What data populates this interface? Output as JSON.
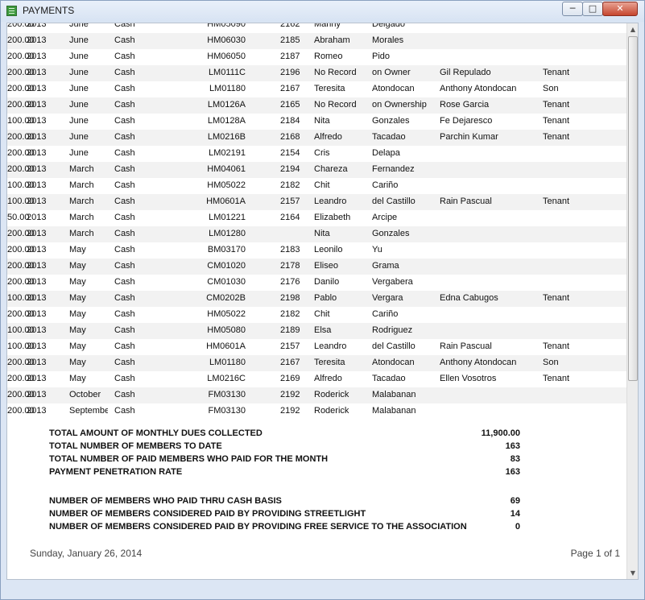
{
  "window": {
    "title": "PAYMENTS",
    "btn_min": "─",
    "btn_max": "□",
    "btn_close": "✕"
  },
  "rows": [
    {
      "year": "2013",
      "month": "June",
      "type": "Cash",
      "code": "HM05090",
      "amount": "200.00",
      "no": "2162",
      "first": "Manny",
      "last": "Delgado",
      "rep": "",
      "rel": ""
    },
    {
      "year": "2013",
      "month": "June",
      "type": "Cash",
      "code": "HM06030",
      "amount": "200.00",
      "no": "2185",
      "first": "Abraham",
      "last": "Morales",
      "rep": "",
      "rel": ""
    },
    {
      "year": "2013",
      "month": "June",
      "type": "Cash",
      "code": "HM06050",
      "amount": "200.00",
      "no": "2187",
      "first": "Romeo",
      "last": "Pido",
      "rep": "",
      "rel": ""
    },
    {
      "year": "2013",
      "month": "June",
      "type": "Cash",
      "code": "LM0111C",
      "amount": "200.00",
      "no": "2196",
      "first": "No Record",
      "last": "on Owner",
      "rep": "Gil Repulado",
      "rel": "Tenant"
    },
    {
      "year": "2013",
      "month": "June",
      "type": "Cash",
      "code": "LM01180",
      "amount": "200.00",
      "no": "2167",
      "first": "Teresita",
      "last": "Atondocan",
      "rep": "Anthony Atondocan",
      "rel": "Son"
    },
    {
      "year": "2013",
      "month": "June",
      "type": "Cash",
      "code": "LM0126A",
      "amount": "200.00",
      "no": "2165",
      "first": "No Record",
      "last": "on Ownership",
      "rep": "Rose Garcia",
      "rel": "Tenant"
    },
    {
      "year": "2013",
      "month": "June",
      "type": "Cash",
      "code": "LM0128A",
      "amount": "100.00",
      "no": "2184",
      "first": "Nita",
      "last": "Gonzales",
      "rep": "Fe Dejaresco",
      "rel": "Tenant"
    },
    {
      "year": "2013",
      "month": "June",
      "type": "Cash",
      "code": "LM0216B",
      "amount": "200.00",
      "no": "2168",
      "first": "Alfredo",
      "last": "Tacadao",
      "rep": "Parchin Kumar",
      "rel": "Tenant"
    },
    {
      "year": "2013",
      "month": "June",
      "type": "Cash",
      "code": "LM02191",
      "amount": "200.00",
      "no": "2154",
      "first": "Cris",
      "last": "Delapa",
      "rep": "",
      "rel": ""
    },
    {
      "year": "2013",
      "month": "March",
      "type": "Cash",
      "code": "HM04061",
      "amount": "200.00",
      "no": "2194",
      "first": "Chareza",
      "last": "Fernandez",
      "rep": "",
      "rel": ""
    },
    {
      "year": "2013",
      "month": "March",
      "type": "Cash",
      "code": "HM05022",
      "amount": "100.00",
      "no": "2182",
      "first": "Chit",
      "last": "Cariño",
      "rep": "",
      "rel": ""
    },
    {
      "year": "2013",
      "month": "March",
      "type": "Cash",
      "code": "HM0601A",
      "amount": "100.00",
      "no": "2157",
      "first": "Leandro",
      "last": "del Castillo",
      "rep": "Rain Pascual",
      "rel": "Tenant"
    },
    {
      "year": "2013",
      "month": "March",
      "type": "Cash",
      "code": "LM01221",
      "amount": "50.00",
      "no": "2164",
      "first": "Elizabeth",
      "last": "Arcipe",
      "rep": "",
      "rel": ""
    },
    {
      "year": "2013",
      "month": "March",
      "type": "Cash",
      "code": "LM01280",
      "amount": "200.00",
      "no": "",
      "first": "Nita",
      "last": "Gonzales",
      "rep": "",
      "rel": ""
    },
    {
      "year": "2013",
      "month": "May",
      "type": "Cash",
      "code": "BM03170",
      "amount": "200.00",
      "no": "2183",
      "first": "Leonilo",
      "last": "Yu",
      "rep": "",
      "rel": ""
    },
    {
      "year": "2013",
      "month": "May",
      "type": "Cash",
      "code": "CM01020",
      "amount": "200.00",
      "no": "2178",
      "first": "Eliseo",
      "last": "Grama",
      "rep": "",
      "rel": ""
    },
    {
      "year": "2013",
      "month": "May",
      "type": "Cash",
      "code": "CM01030",
      "amount": "200.00",
      "no": "2176",
      "first": "Danilo",
      "last": "Vergabera",
      "rep": "",
      "rel": ""
    },
    {
      "year": "2013",
      "month": "May",
      "type": "Cash",
      "code": "CM0202B",
      "amount": "100.00",
      "no": "2198",
      "first": "Pablo",
      "last": "Vergara",
      "rep": "Edna Cabugos",
      "rel": "Tenant"
    },
    {
      "year": "2013",
      "month": "May",
      "type": "Cash",
      "code": "HM05022",
      "amount": "200.00",
      "no": "2182",
      "first": "Chit",
      "last": "Cariño",
      "rep": "",
      "rel": ""
    },
    {
      "year": "2013",
      "month": "May",
      "type": "Cash",
      "code": "HM05080",
      "amount": "100.00",
      "no": "2189",
      "first": "Elsa",
      "last": "Rodriguez",
      "rep": "",
      "rel": ""
    },
    {
      "year": "2013",
      "month": "May",
      "type": "Cash",
      "code": "HM0601A",
      "amount": "100.00",
      "no": "2157",
      "first": "Leandro",
      "last": "del Castillo",
      "rep": "Rain Pascual",
      "rel": "Tenant"
    },
    {
      "year": "2013",
      "month": "May",
      "type": "Cash",
      "code": "LM01180",
      "amount": "200.00",
      "no": "2167",
      "first": "Teresita",
      "last": "Atondocan",
      "rep": "Anthony Atondocan",
      "rel": "Son"
    },
    {
      "year": "2013",
      "month": "May",
      "type": "Cash",
      "code": "LM0216C",
      "amount": "200.00",
      "no": "2169",
      "first": "Alfredo",
      "last": "Tacadao",
      "rep": "Ellen Vosotros",
      "rel": "Tenant"
    },
    {
      "year": "2013",
      "month": "October",
      "type": "Cash",
      "code": "FM03130",
      "amount": "200.00",
      "no": "2192",
      "first": "Roderick",
      "last": "Malabanan",
      "rep": "",
      "rel": ""
    },
    {
      "year": "2013",
      "month": "September",
      "type": "Cash",
      "code": "FM03130",
      "amount": "200.00",
      "no": "2192",
      "first": "Roderick",
      "last": "Malabanan",
      "rep": "",
      "rel": ""
    }
  ],
  "summary": [
    {
      "label": "TOTAL AMOUNT OF MONTHLY DUES COLLECTED",
      "value": "11,900.00"
    },
    {
      "label": "TOTAL NUMBER OF MEMBERS TO DATE",
      "value": "163"
    },
    {
      "label": "TOTAL NUMBER OF PAID MEMBERS WHO PAID FOR THE MONTH",
      "value": "83"
    },
    {
      "label": "PAYMENT PENETRATION RATE",
      "value": "163"
    },
    {
      "label": "NUMBER OF MEMBERS WHO PAID THRU CASH BASIS",
      "value": "69"
    },
    {
      "label": "NUMBER OF MEMBERS CONSIDERED PAID BY PROVIDING STREETLIGHT",
      "value": "14"
    },
    {
      "label": "NUMBER OF MEMBERS CONSIDERED PAID BY PROVIDING FREE SERVICE TO THE ASSOCIATION",
      "value": "0"
    }
  ],
  "footer": {
    "date": "Sunday, January 26, 2014",
    "page": "Page 1 of 1"
  },
  "scrollbar": {
    "up": "▲",
    "down": "▼"
  }
}
